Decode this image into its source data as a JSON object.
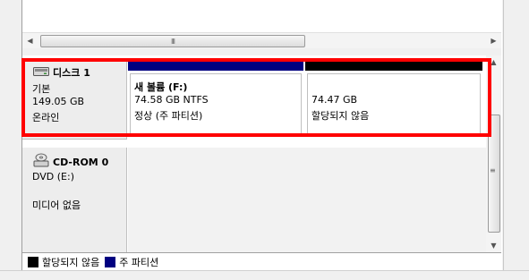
{
  "disks": [
    {
      "name": "디스크 1",
      "type": "기본",
      "size": "149.05 GB",
      "status": "온라인",
      "icon": "hard-disk-icon",
      "partitions": [
        {
          "title": "새 볼륨  (F:)",
          "size": "74.58 GB NTFS",
          "status": "정상 (주 파티션)",
          "bar_color": "#000080"
        },
        {
          "title": "",
          "size": "74.47 GB",
          "status": "할당되지 않음",
          "bar_color": "#000000"
        }
      ]
    },
    {
      "name": "CD-ROM 0",
      "type": "DVD (E:)",
      "media": "미디어 없음",
      "icon": "cdrom-icon"
    }
  ],
  "legend": [
    {
      "label": "할당되지 않음",
      "color": "#000000"
    },
    {
      "label": "주 파티션",
      "color": "#000080"
    }
  ],
  "hscroll_grip": "III",
  "vscroll_grip": "≡",
  "colors": {
    "highlight": "#ff0000"
  }
}
